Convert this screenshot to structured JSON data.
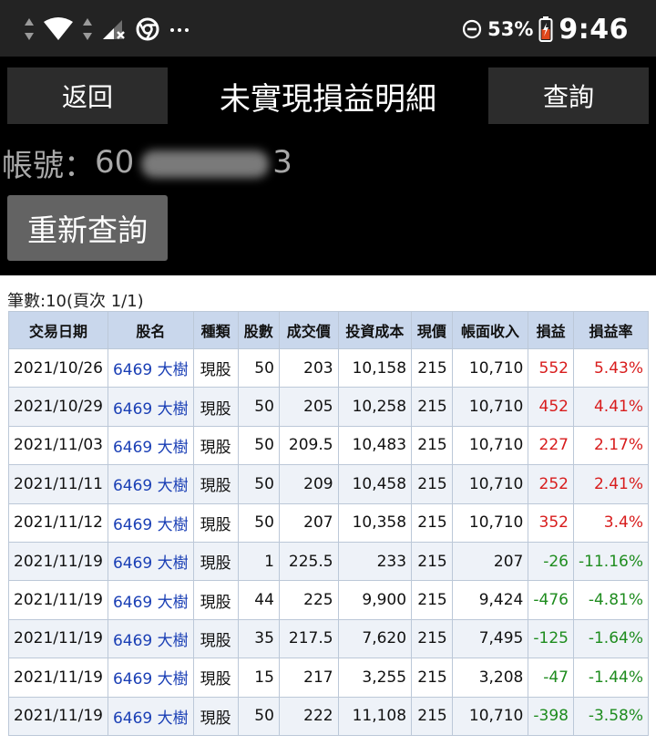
{
  "status_bar": {
    "battery_percent": "53%",
    "time": "9:46",
    "icons": [
      "data-arrows-icon",
      "wifi-icon",
      "data-arrows-icon",
      "cell-signal-icon",
      "chrome-icon",
      "more-icon",
      "do-not-disturb-icon",
      "battery-icon"
    ]
  },
  "header": {
    "back_label": "返回",
    "title": "未實現損益明細",
    "query_label": "查詢"
  },
  "account": {
    "label": "帳號：",
    "prefix": "60",
    "suffix": "3"
  },
  "requery_label": "重新查詢",
  "count_text": "筆數:10(頁次 1/1)",
  "colors": {
    "header_bg": "#c9d7ec",
    "positive": "#d81c1c",
    "negative": "#1e8c1e",
    "stock_link": "#1a3fb5"
  },
  "table": {
    "columns": [
      "交易日期",
      "股名",
      "種類",
      "股數",
      "成交價",
      "投資成本",
      "現價",
      "帳面收入",
      "損益",
      "損益率"
    ],
    "rows": [
      {
        "date": "2021/10/26",
        "stock": "6469 大樹",
        "type": "現股",
        "shares": "50",
        "price": "203",
        "cost": "10,158",
        "current": "215",
        "income": "10,710",
        "pnl": "552",
        "rate": "5.43%"
      },
      {
        "date": "2021/10/29",
        "stock": "6469 大樹",
        "type": "現股",
        "shares": "50",
        "price": "205",
        "cost": "10,258",
        "current": "215",
        "income": "10,710",
        "pnl": "452",
        "rate": "4.41%"
      },
      {
        "date": "2021/11/03",
        "stock": "6469 大樹",
        "type": "現股",
        "shares": "50",
        "price": "209.5",
        "cost": "10,483",
        "current": "215",
        "income": "10,710",
        "pnl": "227",
        "rate": "2.17%"
      },
      {
        "date": "2021/11/11",
        "stock": "6469 大樹",
        "type": "現股",
        "shares": "50",
        "price": "209",
        "cost": "10,458",
        "current": "215",
        "income": "10,710",
        "pnl": "252",
        "rate": "2.41%"
      },
      {
        "date": "2021/11/12",
        "stock": "6469 大樹",
        "type": "現股",
        "shares": "50",
        "price": "207",
        "cost": "10,358",
        "current": "215",
        "income": "10,710",
        "pnl": "352",
        "rate": "3.4%"
      },
      {
        "date": "2021/11/19",
        "stock": "6469 大樹",
        "type": "現股",
        "shares": "1",
        "price": "225.5",
        "cost": "233",
        "current": "215",
        "income": "207",
        "pnl": "-26",
        "rate": "-11.16%"
      },
      {
        "date": "2021/11/19",
        "stock": "6469 大樹",
        "type": "現股",
        "shares": "44",
        "price": "225",
        "cost": "9,900",
        "current": "215",
        "income": "9,424",
        "pnl": "-476",
        "rate": "-4.81%"
      },
      {
        "date": "2021/11/19",
        "stock": "6469 大樹",
        "type": "現股",
        "shares": "35",
        "price": "217.5",
        "cost": "7,620",
        "current": "215",
        "income": "7,495",
        "pnl": "-125",
        "rate": "-1.64%"
      },
      {
        "date": "2021/11/19",
        "stock": "6469 大樹",
        "type": "現股",
        "shares": "15",
        "price": "217",
        "cost": "3,255",
        "current": "215",
        "income": "3,208",
        "pnl": "-47",
        "rate": "-1.44%"
      },
      {
        "date": "2021/11/19",
        "stock": "6469 大樹",
        "type": "現股",
        "shares": "50",
        "price": "222",
        "cost": "11,108",
        "current": "215",
        "income": "10,710",
        "pnl": "-398",
        "rate": "-3.58%"
      }
    ]
  }
}
